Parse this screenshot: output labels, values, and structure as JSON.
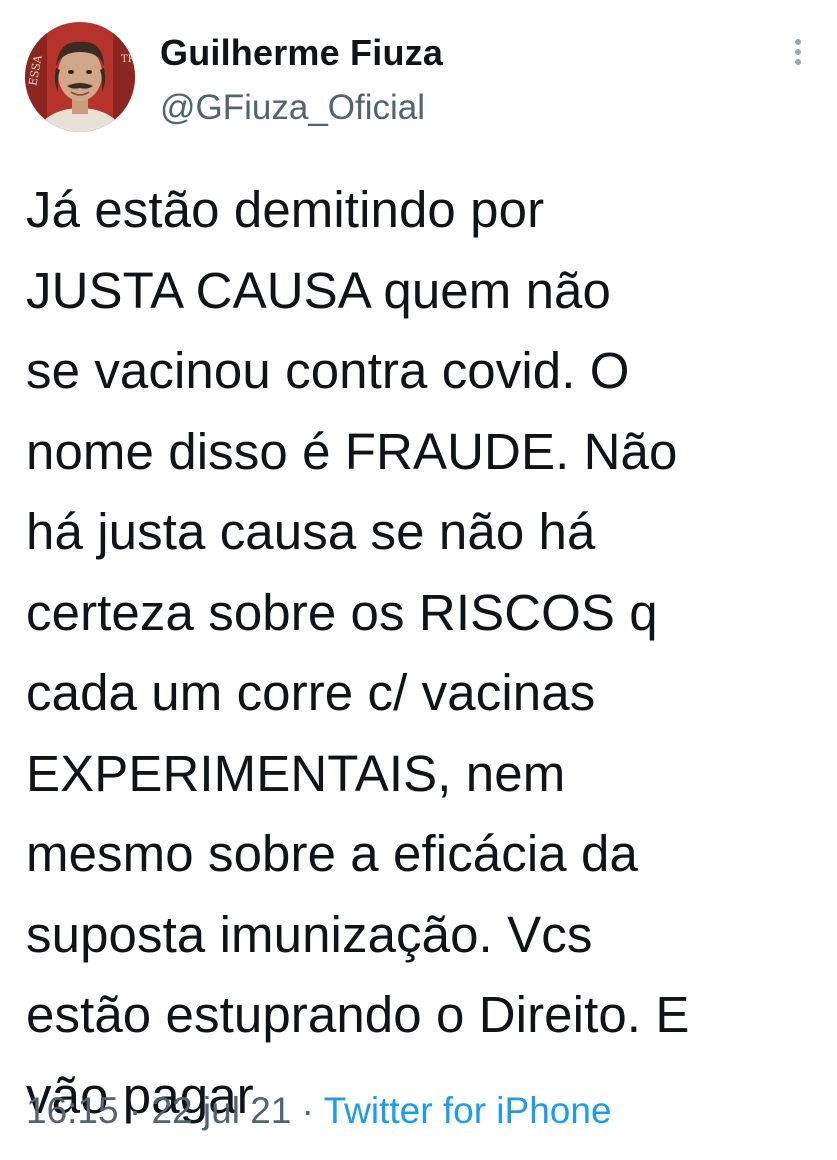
{
  "author": {
    "name": "Guilherme Fiuza",
    "handle": "@GFiuza_Oficial",
    "avatar_icon": "profile-photo"
  },
  "tweet": {
    "text": "Já estão demitindo por\nJUSTA CAUSA quem não\nse vacinou contra covid. O\nnome disso é FRAUDE. Não\nhá justa causa se não há\ncerteza sobre os RISCOS q\ncada um corre c/ vacinas\nEXPERIMENTAIS, nem\nmesmo sobre a eficácia da\nsuposta imunização. Vcs\nestão estuprando o Direito. E\nvão pagar",
    "time": "16:15",
    "separator": "·",
    "date": "22 jul 21",
    "source": "Twitter for iPhone"
  },
  "icons": {
    "more": "more-vertical-icon"
  },
  "colors": {
    "text": "#0f1419",
    "secondary": "#536471",
    "link": "#1d9bf0",
    "avatar_bg": "#b5332b"
  }
}
